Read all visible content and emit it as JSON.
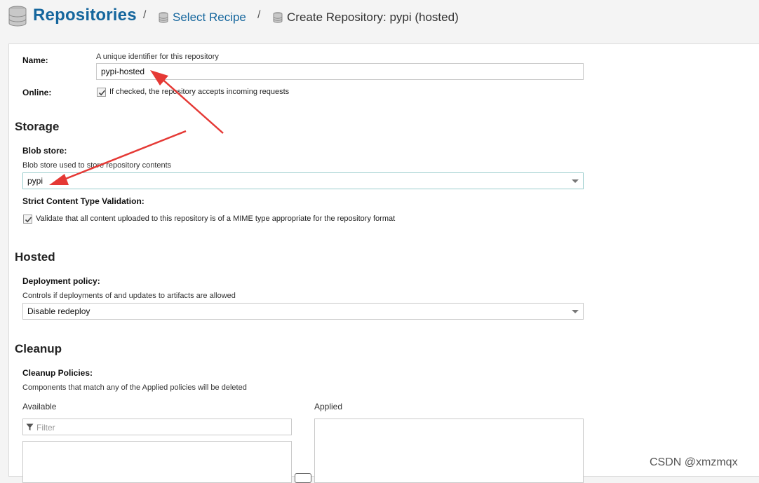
{
  "breadcrumb": {
    "title": "Repositories",
    "sep1": "/",
    "link": "Select Recipe",
    "sep2": "/",
    "current": "Create Repository: pypi (hosted)"
  },
  "form": {
    "name": {
      "label": "Name:",
      "help": "A unique identifier for this repository",
      "value": "pypi-hosted"
    },
    "online": {
      "label": "Online:",
      "checked": true,
      "text": "If checked, the repository accepts incoming requests"
    },
    "storage": {
      "heading": "Storage",
      "blob_label": "Blob store:",
      "blob_help": "Blob store used to store repository contents",
      "blob_value": "pypi",
      "strict_label": "Strict Content Type Validation:",
      "strict_checked": true,
      "strict_text": "Validate that all content uploaded to this repository is of a MIME type appropriate for the repository format"
    },
    "hosted": {
      "heading": "Hosted",
      "policy_label": "Deployment policy:",
      "policy_help": "Controls if deployments of and updates to artifacts are allowed",
      "policy_value": "Disable redeploy"
    },
    "cleanup": {
      "heading": "Cleanup",
      "label": "Cleanup Policies:",
      "help": "Components that match any of the Applied policies will be deleted",
      "available_label": "Available",
      "applied_label": "Applied",
      "filter_placeholder": "Filter"
    }
  },
  "watermark": "CSDN @xmzmqx",
  "colors": {
    "accent": "#15669d",
    "annotation_arrow": "#e53935"
  },
  "icons": [
    "database-icon",
    "checkmark-icon",
    "filter-icon",
    "caret-down-icon"
  ]
}
